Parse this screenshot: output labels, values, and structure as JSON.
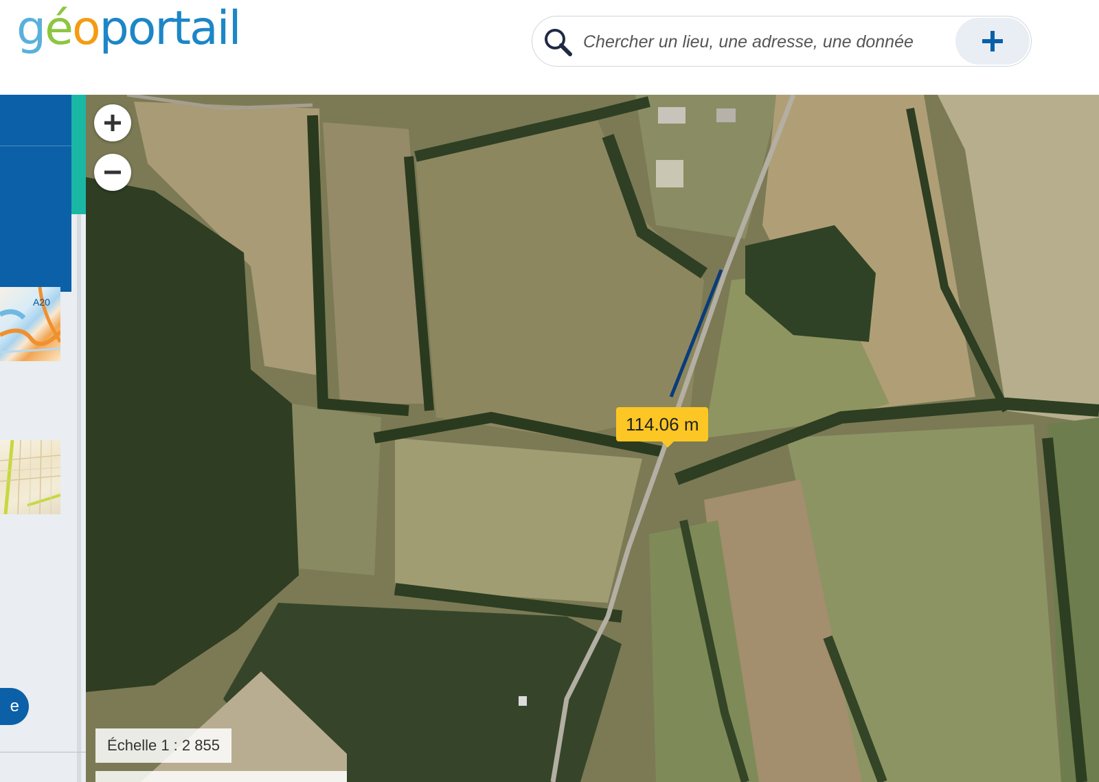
{
  "header": {
    "logo": {
      "g": "g",
      "e": "é",
      "o": "o",
      "rest": "portail"
    },
    "search": {
      "placeholder": "Chercher un lieu, une adresse, une donnée",
      "icon": "search-icon",
      "plus_icon": "plus-icon"
    }
  },
  "left_panel": {
    "thumb1_label": "A20",
    "pill_label": "e"
  },
  "map": {
    "zoom_in_icon": "plus-icon",
    "zoom_out_icon": "minus-icon",
    "measurement": "114.06 m",
    "scale": "Échelle 1 : 2 855"
  },
  "colors": {
    "brand_blue": "#0b60a8",
    "teal_accent": "#1ab7a4",
    "measure_yellow": "#fcc624"
  }
}
